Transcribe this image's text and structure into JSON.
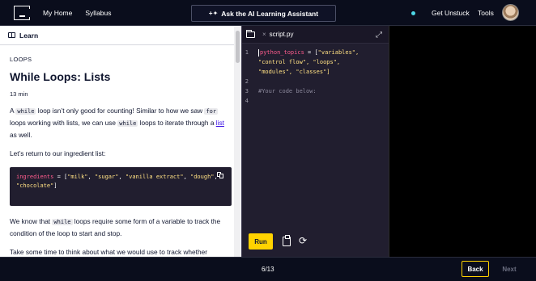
{
  "nav": {
    "home": "My Home",
    "syllabus": "Syllabus",
    "assistant": "Ask the AI Learning Assistant",
    "unstuck": "Get Unstuck",
    "tools": "Tools"
  },
  "learn": {
    "header": "Learn",
    "eyebrow": "LOOPS",
    "title": "While Loops: Lists",
    "duration": "13 min",
    "p1": {
      "a": "A ",
      "code1": "while",
      "b": " loop isn’t only good for counting! Similar to how we saw ",
      "code2": "for",
      "c": " loops working with lists, we can use ",
      "code3": "while",
      "d": " loops to iterate through a ",
      "link": "list",
      "e": " as well."
    },
    "p2": "Let’s return to our ingredient list:",
    "snippet": {
      "var": "ingredients",
      "op": " = [",
      "items": [
        "\"milk\"",
        "\"sugar\"",
        "\"vanilla extract\"",
        "\"dough\"",
        "\"chocolate\""
      ],
      "close": "]"
    },
    "p3": {
      "a": "We know that ",
      "code": "while",
      "b": " loops require some form of a variable to track the condition of the loop to start and stop."
    },
    "p4": "Take some time to think about what we would use to track whether"
  },
  "editor": {
    "file": "script.py",
    "lines": [
      {
        "n": "1",
        "var": "python_topics",
        "rest": " = [\"variables\","
      },
      {
        "n": "",
        "rest": "\"control flow\", \"loops\","
      },
      {
        "n": "",
        "rest": "\"modules\", \"classes\"]"
      },
      {
        "n": "2",
        "rest": ""
      },
      {
        "n": "3",
        "comment": "#Your code below:"
      },
      {
        "n": "4",
        "rest": ""
      }
    ],
    "run": "Run"
  },
  "footer": {
    "progress": "6/13",
    "back": "Back",
    "next": "Next"
  },
  "colors": {
    "accent": "#ffd300",
    "link": "#3a10e5",
    "status": "#4ed7e6"
  }
}
